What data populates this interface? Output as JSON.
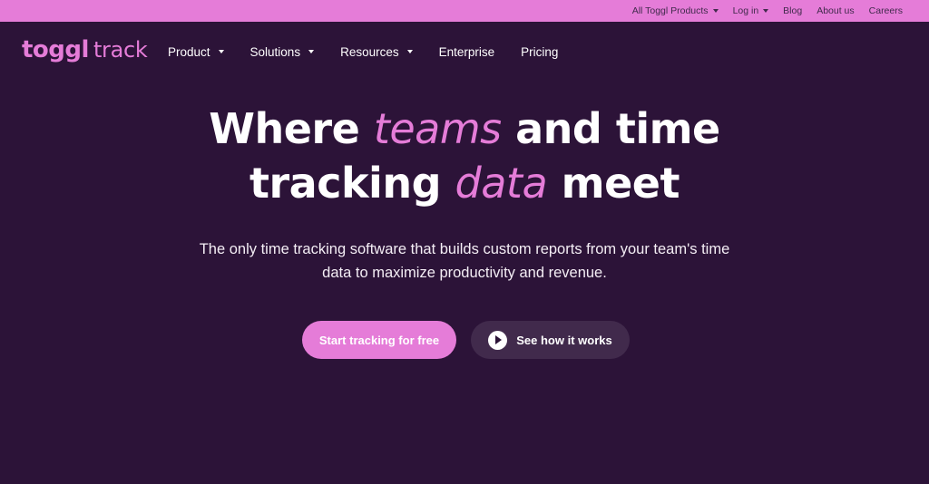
{
  "topbar": {
    "items": [
      {
        "label": "All Toggl Products",
        "has_dropdown": true
      },
      {
        "label": "Log in",
        "has_dropdown": true
      },
      {
        "label": "Blog",
        "has_dropdown": false
      },
      {
        "label": "About us",
        "has_dropdown": false
      },
      {
        "label": "Careers",
        "has_dropdown": false
      }
    ]
  },
  "logo": {
    "brand": "toggl",
    "product": "track"
  },
  "nav": {
    "items": [
      {
        "label": "Product",
        "has_dropdown": true
      },
      {
        "label": "Solutions",
        "has_dropdown": true
      },
      {
        "label": "Resources",
        "has_dropdown": true
      },
      {
        "label": "Enterprise",
        "has_dropdown": false
      },
      {
        "label": "Pricing",
        "has_dropdown": false
      }
    ]
  },
  "hero": {
    "line1_start": "Where ",
    "line1_accent": "teams",
    "line1_end": " and time",
    "line2_start": "tracking ",
    "line2_accent": "data",
    "line2_end": " meet",
    "subtitle_line1": "The only time tracking software that builds custom reports from your team's time",
    "subtitle_line2": "data to maximize productivity and revenue."
  },
  "cta": {
    "primary_label": "Start tracking for free",
    "secondary_label": "See how it works",
    "secondary_icon": "play-icon"
  },
  "colors": {
    "background": "#2c1338",
    "accent": "#e57cd8",
    "topbar": "#e57cd8",
    "secondary_button": "#412a4c"
  }
}
